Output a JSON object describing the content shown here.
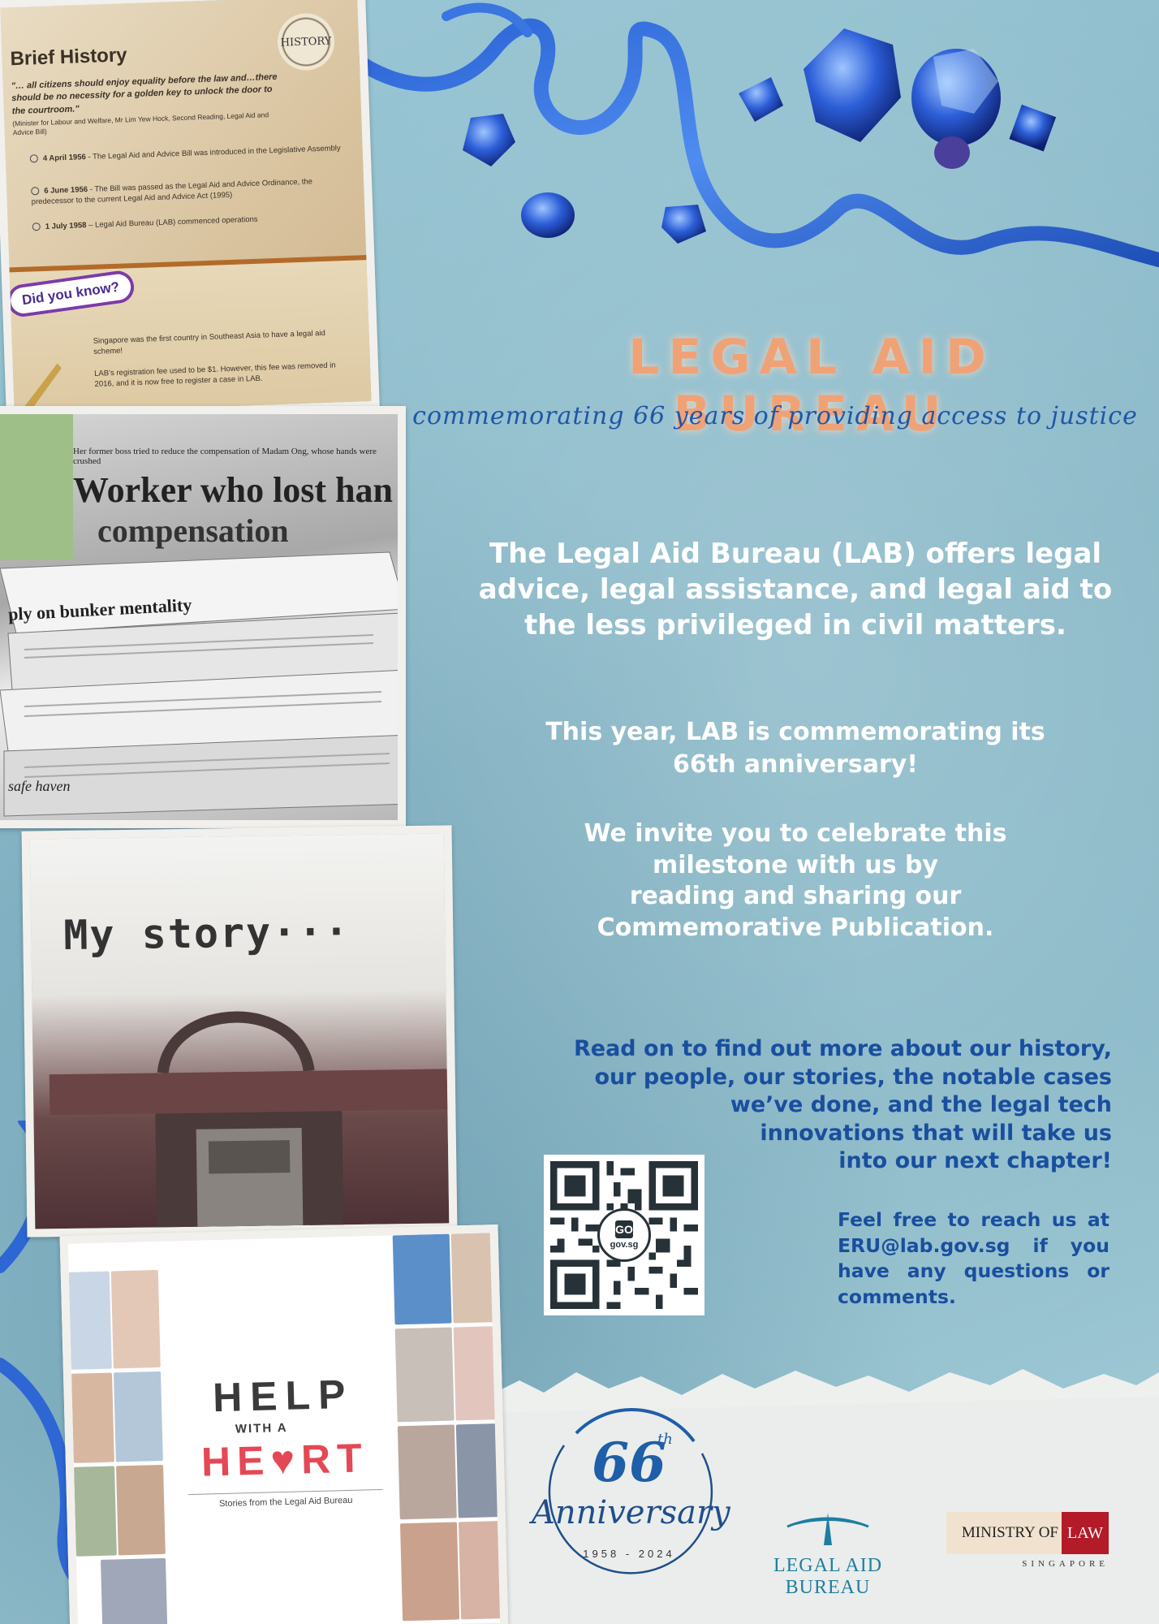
{
  "header": {
    "title": "LEGAL AID BUREAU",
    "subtitle": "commemorating 66 years of providing access to justice"
  },
  "body": {
    "intro": "The Legal Aid Bureau (LAB) offers legal advice, legal assistance, and legal aid to the less privileged in civil matters.",
    "anniversary_lines": [
      "This year, LAB is commemorating its",
      "66th anniversary!"
    ],
    "invite_lines": [
      "We invite you to celebrate this",
      "milestone with us by",
      "reading and sharing our",
      "Commemorative Publication."
    ],
    "read_on_lines": [
      "Read on to find out more about our history,",
      "our people, our stories, the notable cases",
      "we’ve done, and the legal tech",
      "innovations that will take us",
      "into our next chapter!"
    ],
    "contact": "Feel free to reach us at ERU@lab.gov.sg if you have any questions or comments."
  },
  "qr": {
    "label": "GO",
    "domain": "gov.sg"
  },
  "collage": {
    "history": {
      "stamp": "HISTORY",
      "title": "Brief History",
      "quote": "\"… all citizens should enjoy equality before the law and…there should be no necessity for a golden key to unlock the door to the courtroom.\"",
      "attribution": "(Minister for Labour and Welfare, Mr Lim Yew Hock, Second Reading, Legal Aid and Advice Bill)",
      "timeline": [
        {
          "date": "4 April 1956",
          "text": " - The Legal Aid and Advice Bill was introduced in the Legislative Assembly"
        },
        {
          "date": "6 June 1956",
          "text": " - The Bill was passed as the Legal Aid and Advice Ordinance, the predecessor to the current Legal Aid and Advice Act (1995)"
        },
        {
          "date": "1 July 1958",
          "text": " – Legal Aid Bureau (LAB) commenced operations"
        }
      ],
      "did_you_know": "Did you know?",
      "facts": [
        "Singapore was the first country in Southeast Asia to have a legal aid scheme!",
        "LAB’s registration fee used to be $1. However, this fee was removed in 2016, and it is now free to register a case in LAB."
      ]
    },
    "news": {
      "line": "Her former boss tried to reduce the compensation of Madam Ong, whose hands were crushed",
      "headline1": "Worker who lost han",
      "headline2": "compensation",
      "headline3": "ply on bunker mentality",
      "headline4": "safe haven"
    },
    "story": {
      "text": "My story···"
    },
    "book": {
      "word1": "HELP",
      "word2": "WITH A",
      "word3": "HE♥RT",
      "caption": "Stories from the Legal Aid Bureau"
    }
  },
  "logos": {
    "anniversary": {
      "number": "66",
      "suffix": "th",
      "word": "Anniversary",
      "years": "1958 - 2024"
    },
    "lab": "LEGAL AID BUREAU",
    "mol": {
      "left": "MINISTRY OF",
      "right": "LAW",
      "country": "SINGAPORE"
    }
  },
  "colors": {
    "background": "#8fbccb",
    "title": "#f0a277",
    "subtitle": "#1f56a8",
    "blue_text": "#1a4e9e",
    "white_text": "#ffffff"
  }
}
